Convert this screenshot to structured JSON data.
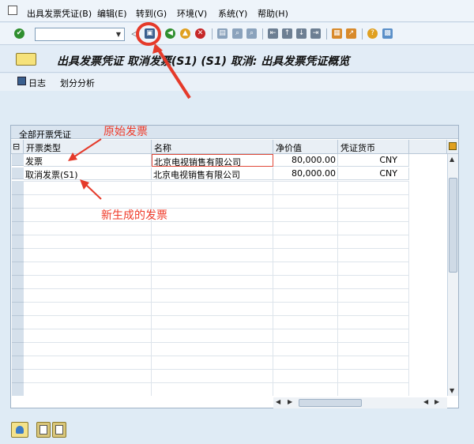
{
  "menu": {
    "items": [
      {
        "label": "出具发票凭证(B)"
      },
      {
        "label": "编辑(E)"
      },
      {
        "label": "转到(G)"
      },
      {
        "label": "环境(V)"
      },
      {
        "label": "系统(Y)"
      },
      {
        "label": "帮助(H)"
      }
    ]
  },
  "toolbar": {
    "command_value": "",
    "icons": [
      "enter-icon",
      "back-icon",
      "save-icon",
      "green-arrow-back-icon",
      "exit-icon",
      "cancel-icon",
      "print-icon",
      "find-icon",
      "find-next-icon",
      "first-page-icon",
      "prev-page-icon",
      "next-page-icon",
      "last-page-icon",
      "new-session-icon",
      "shortcut-icon",
      "help-icon",
      "customize-layout-icon"
    ]
  },
  "title": {
    "text": "出具发票凭证 取消发票(S1) (S1) 取消: 出具发票凭证概览"
  },
  "appbar": {
    "log_label": "日志",
    "split_label": "划分分析"
  },
  "grid": {
    "title": "全部开票凭证",
    "columns": [
      "开票类型",
      "名称",
      "净价值",
      "凭证货币"
    ],
    "rows": [
      [
        "发票",
        "北京电视销售有限公司",
        "80,000.00",
        "CNY"
      ],
      [
        "取消发票(S1)",
        "北京电视销售有限公司",
        "80,000.00",
        "CNY"
      ]
    ]
  },
  "annotations": {
    "original_invoice": "原始发票",
    "new_invoice": "新生成的发票"
  },
  "colors": {
    "annotation": "#ef3b2a",
    "save_circle": "#e53a2a"
  }
}
